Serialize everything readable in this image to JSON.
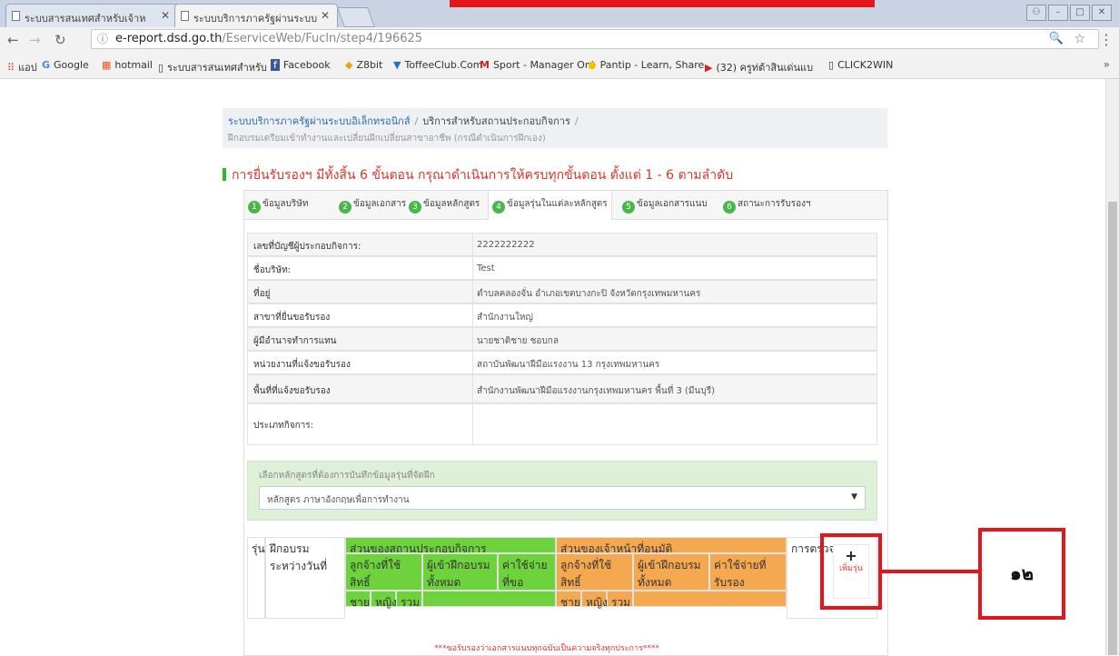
{
  "browser": {
    "tabs": [
      {
        "title": "ระบบสารสนเทศสำหรับเจ้าห"
      },
      {
        "title": "ระบบบริการภาครัฐผ่านระบบ"
      }
    ],
    "url_domain": "e-report.dsd.go.th",
    "url_path": "/EserviceWeb/Fucln/step4/196625",
    "bookmarks": [
      "แอป",
      "Google",
      "hotmail",
      "ระบบสารสนเทศสำหรับ",
      "Facebook",
      "Z8bit",
      "ToffeeClub.Com",
      "Sport - Manager Onl",
      "Pantip - Learn, Share",
      "(32) ครูท่ต้าสินเด่นแบ",
      "CLICK2WIN"
    ],
    "more": "»"
  },
  "breadcrumb": {
    "system": "ระบบบริการภาครัฐผ่านระบบอิเล็กทรอนิกส์",
    "section": "บริการสำหรับสถานประกอบกิจการ",
    "sub": "ฝึกอบรมเตรียมเข้าทำงานและเปลี่ยนฝึกเปลี่ยนสาขาอาชีพ (กรณีดำเนินการฝึกเอง)"
  },
  "warning": "การยื่นรับรองฯ มีทั้งสิ้น 6 ขั้นตอน กรุณาดำเนินการให้ครบทุกขั้นตอน ตั้งแต่ 1 - 6 ตามลำดับ",
  "steps": [
    {
      "num": "1",
      "label": "ข้อมูลบริษัท"
    },
    {
      "num": "2",
      "label": "ข้อมูลเอกสาร"
    },
    {
      "num": "3",
      "label": "ข้อมูลหลักสูตร"
    },
    {
      "num": "4",
      "label": "ข้อมูลรุ่นในแต่ละหลักสูตร"
    },
    {
      "num": "5",
      "label": "ข้อมูลเอกสารแนบ"
    },
    {
      "num": "6",
      "label": "สถานะการรับรองฯ"
    }
  ],
  "info_rows": [
    {
      "label": "เลขที่บัญชีผู้ประกอบกิจการ:",
      "value": "2222222222"
    },
    {
      "label": "ชื่อบริษัท:",
      "value": "Test"
    },
    {
      "label": "ที่อยู่",
      "value": "ตำบลคลองจั่น อำเภอเขตบางกะปิ จังหวัดกรุงเทพมหานคร"
    },
    {
      "label": "สาขาที่ยื่นขอรับรอง",
      "value": "สำนักงานใหญ่"
    },
    {
      "label": "ผู้มีอำนาจทำการแทน",
      "value": "นายชาติชาย ชอบกล"
    },
    {
      "label": "หน่วยงานที่แจ้งขอรับรอง",
      "value": "สถาบันพัฒนาฝีมือแรงงาน 13 กรุงเทพมหานคร"
    },
    {
      "label": "พื้นที่ที่แจ้งขอรับรอง",
      "value": "สำนักงานพัฒนาฝีมือแรงงานกรุงเทพมหานคร พื้นที่ 3 (มีนบุรี)"
    },
    {
      "label": "ประเภทกิจการ:",
      "value": ""
    }
  ],
  "course_select": {
    "hint": "เลือกหลักสูตรที่ต้องการบันทึกข้อมูลรุ่นที่จัดฝึก",
    "value": "หลักสูตร ภาษาอังกฤษเพื่อการทำงาน"
  },
  "table": {
    "col_batch": "รุ่น",
    "col_period": "ฝึกอบรมระหว่างวันที่",
    "grp_company": "ส่วนของสถานประกอบกิจการ",
    "grp_officer": "ส่วนของเจ้าหน้าที่อนุมัติ",
    "col_check": "การตรวจสอบ",
    "trained": "ลูกจ้างที่ใช้สิทธิ์",
    "all_trained": "ผู้เข้าฝึกอบรมทั้งหมด",
    "cost": "ค่าใช้จ่ายที่ขอ",
    "cost_approved": "ค่าใช้จ่ายที่รับรอง",
    "male": "ชาย",
    "female": "หญิง",
    "total": "รวม",
    "add_plus": "+",
    "add_label": "เพิ่มรุ่น",
    "note": "***ขอรับรองว่าเอกสารแนบทุกฉบับเป็นความจริงทุกประการ****"
  },
  "callout": "๑๒"
}
